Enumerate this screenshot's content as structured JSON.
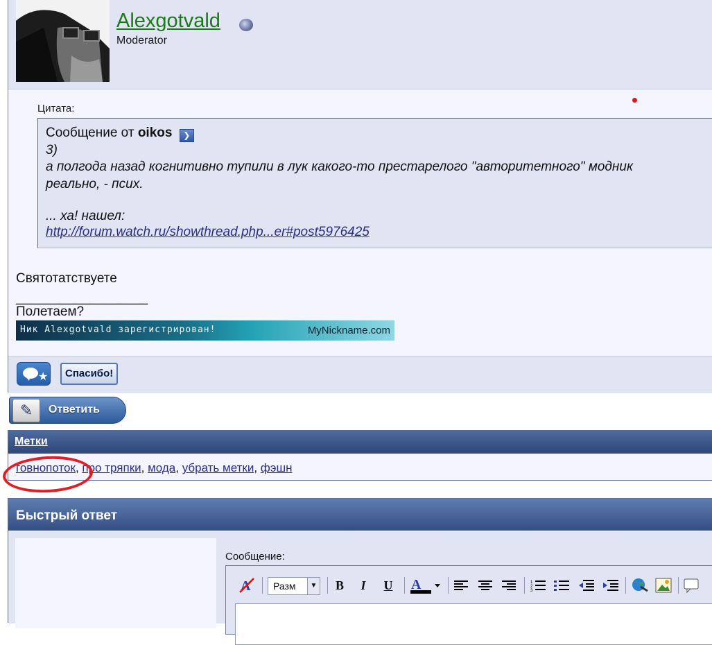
{
  "post": {
    "username": "Alexgotvald",
    "usertitle": "Moderator",
    "quote_label": "Цитата:",
    "quote_from_prefix": "Сообщение от",
    "quote_author": "oikos",
    "quote_lines": [
      "3)",
      "а полгода назад когнитивно тупили в лук какого-то престарелого \"авторитетного\" модник",
      "реально, - псих.",
      "",
      "... ха! нашел:"
    ],
    "quote_link": "http://forum.watch.ru/showthread.php...er#post5976425",
    "message": "Святотатствуете",
    "sig_separator": "__________________",
    "sig_text": "Полетаем?",
    "sig_banner_left": "Ник Alexgotvald зарегистрирован!",
    "sig_banner_right": "MyNickname.com",
    "thanks_label": "Спасибо!"
  },
  "reply_button": {
    "label": "Ответить"
  },
  "tags": {
    "title": "Метки",
    "items": [
      "говнопоток",
      "про тряпки",
      "мода",
      "убрать метки",
      "фэшн"
    ],
    "separator": ", "
  },
  "quick_reply": {
    "title": "Быстрый ответ",
    "message_label": "Сообщение:",
    "size_select_value": "Разм"
  },
  "icons": {
    "online": "online-status-icon",
    "view_post": "view-post-arrow-icon",
    "quote": "quote-bubble-icon",
    "reply": "reply-pencil-icon"
  },
  "colors": {
    "username": "#1a7a1a",
    "link": "#2a2f86",
    "header_bar": "#2f4778",
    "highlight_circle": "#e21d24"
  }
}
